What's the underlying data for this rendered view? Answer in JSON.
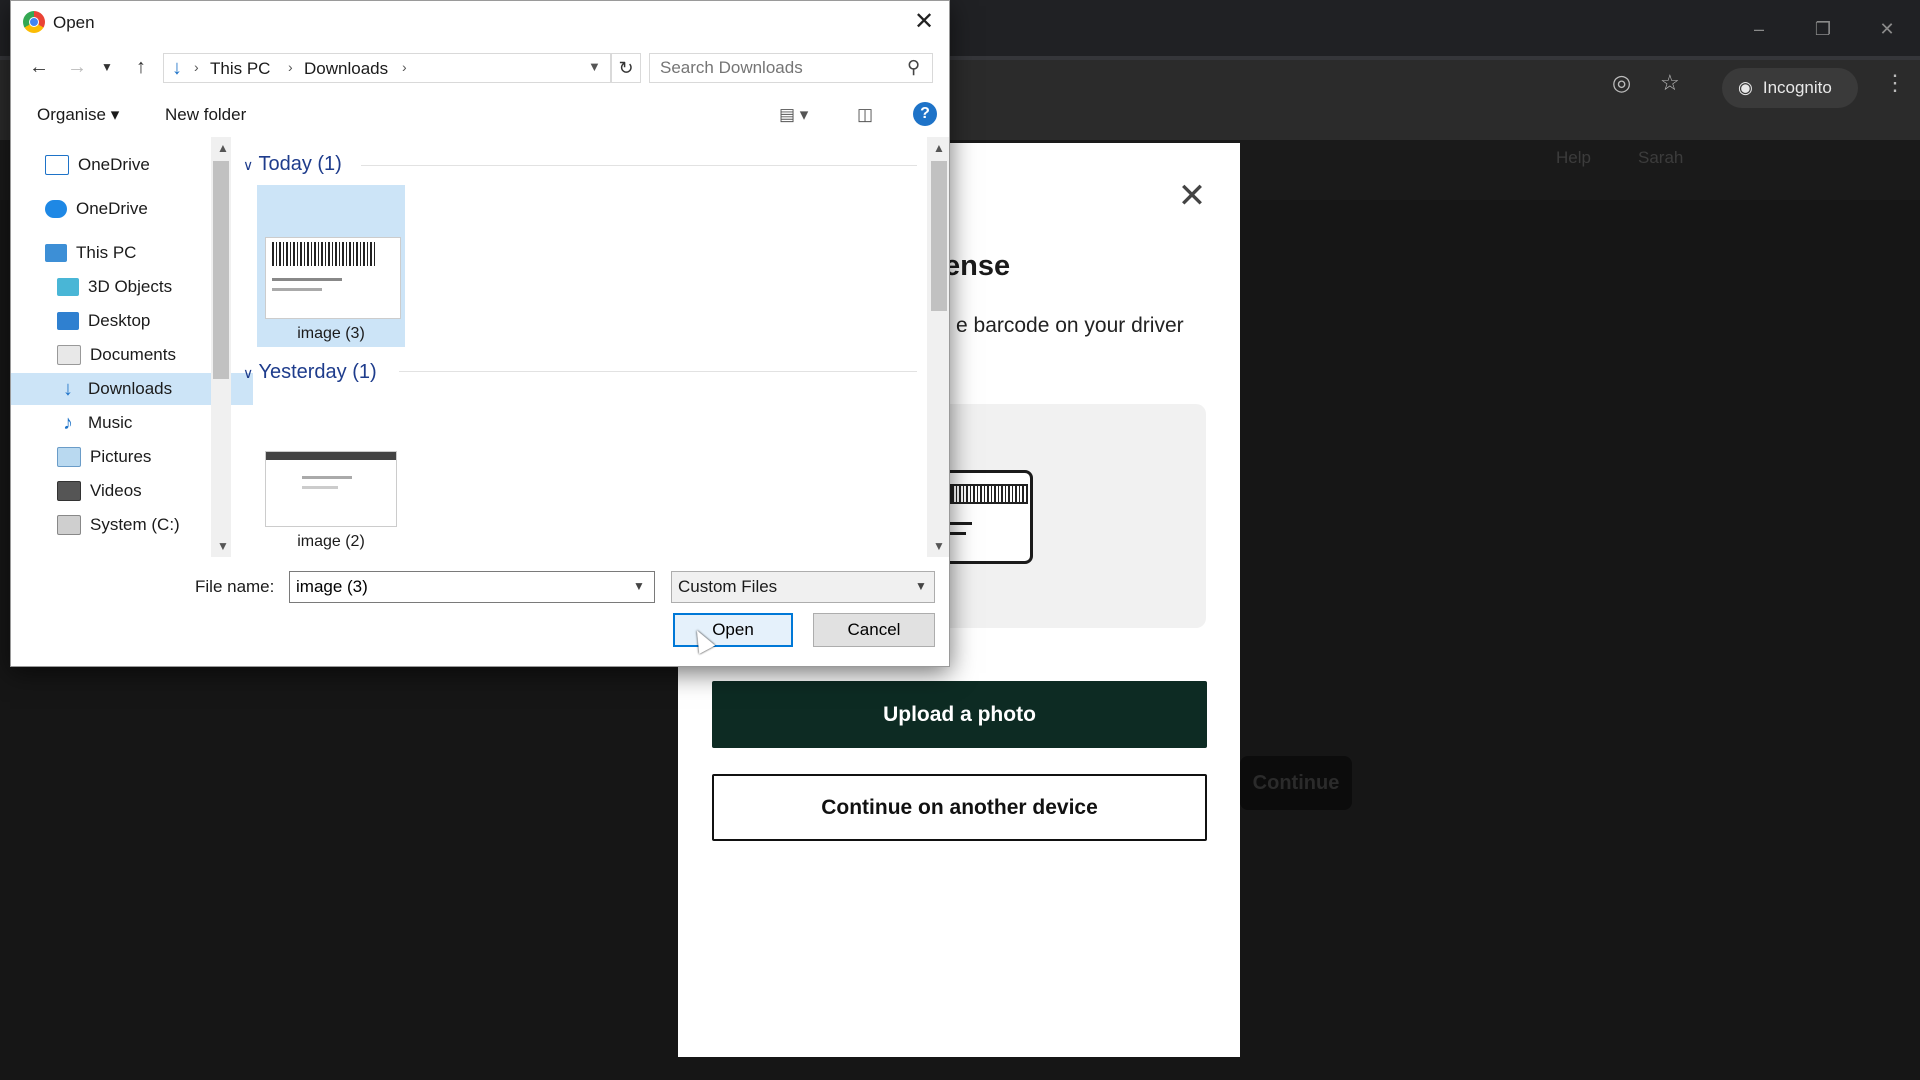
{
  "browser": {
    "incognito_label": "Incognito",
    "header_help": "Help",
    "header_user": "Sarah",
    "ghost_button": "Continue"
  },
  "modal": {
    "title_fragment": "ense",
    "description_fragment": "e barcode on your driver",
    "upload_button": "Upload a photo",
    "continue_button": "Continue on another device"
  },
  "dialog": {
    "title": "Open",
    "breadcrumb": [
      "This PC",
      "Downloads"
    ],
    "search_placeholder": "Search Downloads",
    "organise_label": "Organise",
    "new_folder_label": "New folder",
    "nav_items": [
      {
        "label": "OneDrive",
        "icon": "onedrive-business-icon"
      },
      {
        "label": "OneDrive",
        "icon": "onedrive-icon"
      },
      {
        "label": "This PC",
        "icon": "computer-icon"
      },
      {
        "label": "3D Objects",
        "icon": "3d-objects-icon"
      },
      {
        "label": "Desktop",
        "icon": "desktop-icon"
      },
      {
        "label": "Documents",
        "icon": "documents-icon"
      },
      {
        "label": "Downloads",
        "icon": "downloads-icon",
        "selected": true
      },
      {
        "label": "Music",
        "icon": "music-icon"
      },
      {
        "label": "Pictures",
        "icon": "pictures-icon"
      },
      {
        "label": "Videos",
        "icon": "videos-icon"
      },
      {
        "label": "System (C:)",
        "icon": "drive-icon"
      }
    ],
    "groups": [
      {
        "header": "Today (1)",
        "files": [
          {
            "name": "image (3)",
            "selected": true
          }
        ]
      },
      {
        "header": "Yesterday (1)",
        "files": [
          {
            "name": "image (2)"
          }
        ]
      }
    ],
    "file_name_label": "File name:",
    "file_name_value": "image (3)",
    "file_type": "Custom Files",
    "open_button": "Open",
    "cancel_button": "Cancel"
  },
  "colors": {
    "accent_blue": "#0078d7",
    "selection": "#cce4f7",
    "primary_button": "#0d2b23"
  }
}
